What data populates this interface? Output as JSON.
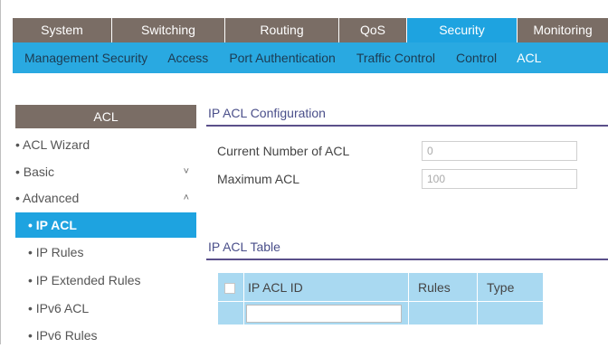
{
  "top_tabs": [
    {
      "label": "System",
      "active": false
    },
    {
      "label": "Switching",
      "active": false
    },
    {
      "label": "Routing",
      "active": false
    },
    {
      "label": "QoS",
      "active": false
    },
    {
      "label": "Security",
      "active": true
    },
    {
      "label": "Monitoring",
      "active": false
    }
  ],
  "sub_nav": [
    {
      "label": "Management Security",
      "active": false
    },
    {
      "label": "Access",
      "active": false
    },
    {
      "label": "Port Authentication",
      "active": false
    },
    {
      "label": "Traffic Control",
      "active": false
    },
    {
      "label": "Control",
      "active": false
    },
    {
      "label": "ACL",
      "active": true
    }
  ],
  "sidebar": {
    "header": "ACL",
    "items": [
      {
        "label": "• ACL Wizard"
      },
      {
        "label": "• Basic",
        "chevron": "˅"
      },
      {
        "label": "• Advanced",
        "chevron": "˄"
      },
      {
        "label": "• IP ACL",
        "active": true
      },
      {
        "label": "• IP Rules"
      },
      {
        "label": "• IP Extended Rules"
      },
      {
        "label": "• IPv6 ACL"
      },
      {
        "label": "• IPv6 Rules"
      }
    ]
  },
  "config": {
    "title": "IP ACL Configuration",
    "current_label": "Current Number of ACL",
    "current_value": "0",
    "max_label": "Maximum ACL",
    "max_value": "100"
  },
  "table": {
    "title": "IP ACL Table",
    "columns": [
      "IP ACL ID",
      "Rules",
      "Type"
    ]
  },
  "colors": {
    "tab_bg": "#7a6d65",
    "accent": "#1ea3e0",
    "subnav_bg": "#29a9e1",
    "table_bg": "#a9d9f1",
    "section_title": "#4a4f8a"
  }
}
